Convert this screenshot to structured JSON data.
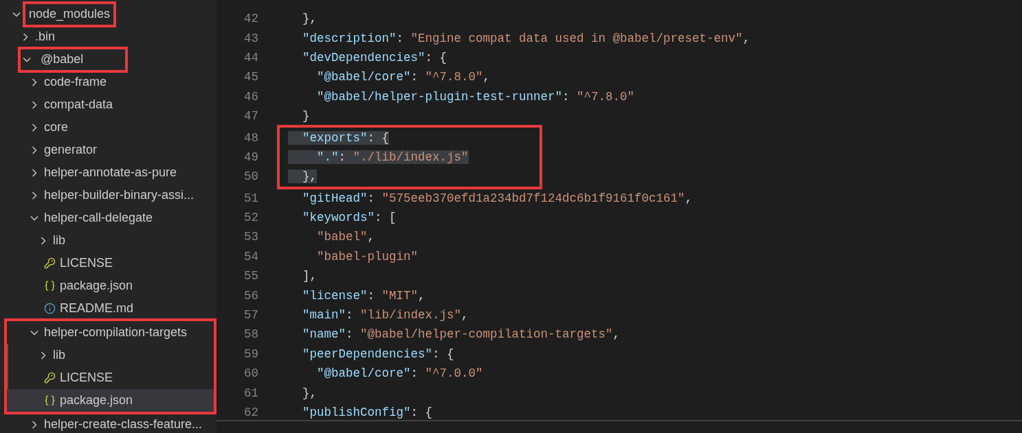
{
  "explorer": {
    "items": [
      {
        "name": "node_modules",
        "kind": "folder",
        "expanded": true,
        "selected": false,
        "label_boxed": true,
        "children": [
          {
            "name": ".bin",
            "kind": "folder",
            "expanded": false,
            "selected": false
          },
          {
            "name": "@babel",
            "kind": "folder",
            "expanded": true,
            "selected": false,
            "row_boxed": true,
            "children": [
              {
                "name": "code-frame",
                "kind": "folder",
                "expanded": false,
                "selected": false
              },
              {
                "name": "compat-data",
                "kind": "folder",
                "expanded": false,
                "selected": false
              },
              {
                "name": "core",
                "kind": "folder",
                "expanded": false,
                "selected": false
              },
              {
                "name": "generator",
                "kind": "folder",
                "expanded": false,
                "selected": false
              },
              {
                "name": "helper-annotate-as-pure",
                "kind": "folder",
                "expanded": false,
                "selected": false
              },
              {
                "name": "helper-builder-binary-assi...",
                "kind": "folder",
                "expanded": false,
                "selected": false
              },
              {
                "name": "helper-call-delegate",
                "kind": "folder",
                "expanded": true,
                "selected": false,
                "children": [
                  {
                    "name": "lib",
                    "kind": "folder",
                    "expanded": false,
                    "selected": false
                  },
                  {
                    "name": "LICENSE",
                    "kind": "license",
                    "selected": false
                  },
                  {
                    "name": "package.json",
                    "kind": "json",
                    "selected": false
                  },
                  {
                    "name": "README.md",
                    "kind": "readme",
                    "selected": false
                  }
                ]
              },
              {
                "name": "helper-compilation-targets",
                "kind": "folder",
                "expanded": true,
                "selected": false,
                "group_boxed": true,
                "children": [
                  {
                    "name": "lib",
                    "kind": "folder",
                    "expanded": false,
                    "selected": false
                  },
                  {
                    "name": "LICENSE",
                    "kind": "license",
                    "selected": false
                  },
                  {
                    "name": "package.json",
                    "kind": "json",
                    "selected": true
                  }
                ]
              },
              {
                "name": "helper-create-class-feature...",
                "kind": "folder",
                "expanded": false,
                "selected": false
              }
            ]
          }
        ]
      }
    ]
  },
  "editor": {
    "lines": [
      {
        "number": "42",
        "selected": false,
        "boxed": false,
        "tokens": [
          {
            "kind": "punct",
            "text": "  },"
          }
        ]
      },
      {
        "number": "43",
        "selected": false,
        "boxed": false,
        "tokens": [
          {
            "kind": "key",
            "text": "  \"description\""
          },
          {
            "kind": "punct",
            "text": ": "
          },
          {
            "kind": "string",
            "text": "\"Engine compat data used in @babel/preset-env\""
          },
          {
            "kind": "punct",
            "text": ","
          }
        ]
      },
      {
        "number": "44",
        "selected": false,
        "boxed": false,
        "tokens": [
          {
            "kind": "key",
            "text": "  \"devDependencies\""
          },
          {
            "kind": "punct",
            "text": ": {"
          }
        ]
      },
      {
        "number": "45",
        "selected": false,
        "boxed": false,
        "tokens": [
          {
            "kind": "key",
            "text": "    \"@babel/core\""
          },
          {
            "kind": "punct",
            "text": ": "
          },
          {
            "kind": "string",
            "text": "\"^7.8.0\""
          },
          {
            "kind": "punct",
            "text": ","
          }
        ]
      },
      {
        "number": "46",
        "selected": false,
        "boxed": false,
        "tokens": [
          {
            "kind": "key",
            "text": "    \"@babel/helper-plugin-test-runner\""
          },
          {
            "kind": "punct",
            "text": ": "
          },
          {
            "kind": "string",
            "text": "\"^7.8.0\""
          }
        ]
      },
      {
        "number": "47",
        "selected": false,
        "boxed": false,
        "tokens": [
          {
            "kind": "punct",
            "text": "  }"
          }
        ]
      },
      {
        "number": "48",
        "selected": true,
        "boxed": true,
        "tokens": [
          {
            "kind": "key",
            "text": "  \"exports\""
          },
          {
            "kind": "punct",
            "text": ": {"
          }
        ]
      },
      {
        "number": "49",
        "selected": true,
        "boxed": true,
        "tokens": [
          {
            "kind": "key",
            "text": "    \".\""
          },
          {
            "kind": "punct",
            "text": ": "
          },
          {
            "kind": "string",
            "text": "\"./lib/index.js\""
          }
        ]
      },
      {
        "number": "50",
        "selected": true,
        "boxed": true,
        "tokens": [
          {
            "kind": "punct",
            "text": "  },"
          }
        ]
      },
      {
        "number": "51",
        "selected": false,
        "boxed": false,
        "tokens": [
          {
            "kind": "key",
            "text": "  \"gitHead\""
          },
          {
            "kind": "punct",
            "text": ": "
          },
          {
            "kind": "string",
            "text": "\"575eeb370efd1a234bd7f124dc6b1f9161f0c161\""
          },
          {
            "kind": "punct",
            "text": ","
          }
        ]
      },
      {
        "number": "52",
        "selected": false,
        "boxed": false,
        "tokens": [
          {
            "kind": "key",
            "text": "  \"keywords\""
          },
          {
            "kind": "punct",
            "text": ": ["
          }
        ]
      },
      {
        "number": "53",
        "selected": false,
        "boxed": false,
        "tokens": [
          {
            "kind": "string",
            "text": "    \"babel\""
          },
          {
            "kind": "punct",
            "text": ","
          }
        ]
      },
      {
        "number": "54",
        "selected": false,
        "boxed": false,
        "tokens": [
          {
            "kind": "string",
            "text": "    \"babel-plugin\""
          }
        ]
      },
      {
        "number": "55",
        "selected": false,
        "boxed": false,
        "tokens": [
          {
            "kind": "punct",
            "text": "  ],"
          }
        ]
      },
      {
        "number": "56",
        "selected": false,
        "boxed": false,
        "tokens": [
          {
            "kind": "key",
            "text": "  \"license\""
          },
          {
            "kind": "punct",
            "text": ": "
          },
          {
            "kind": "string",
            "text": "\"MIT\""
          },
          {
            "kind": "punct",
            "text": ","
          }
        ]
      },
      {
        "number": "57",
        "selected": false,
        "boxed": false,
        "tokens": [
          {
            "kind": "key",
            "text": "  \"main\""
          },
          {
            "kind": "punct",
            "text": ": "
          },
          {
            "kind": "string",
            "text": "\"lib/index.js\""
          },
          {
            "kind": "punct",
            "text": ","
          }
        ]
      },
      {
        "number": "58",
        "selected": false,
        "boxed": false,
        "tokens": [
          {
            "kind": "key",
            "text": "  \"name\""
          },
          {
            "kind": "punct",
            "text": ": "
          },
          {
            "kind": "string",
            "text": "\"@babel/helper-compilation-targets\""
          },
          {
            "kind": "punct",
            "text": ","
          }
        ]
      },
      {
        "number": "59",
        "selected": false,
        "boxed": false,
        "tokens": [
          {
            "kind": "key",
            "text": "  \"peerDependencies\""
          },
          {
            "kind": "punct",
            "text": ": {"
          }
        ]
      },
      {
        "number": "60",
        "selected": false,
        "boxed": false,
        "tokens": [
          {
            "kind": "key",
            "text": "    \"@babel/core\""
          },
          {
            "kind": "punct",
            "text": ": "
          },
          {
            "kind": "string",
            "text": "\"^7.0.0\""
          }
        ]
      },
      {
        "number": "61",
        "selected": false,
        "boxed": false,
        "tokens": [
          {
            "kind": "punct",
            "text": "  },"
          }
        ]
      },
      {
        "number": "62",
        "selected": false,
        "boxed": false,
        "tokens": [
          {
            "kind": "key",
            "text": "  \"publishConfig\""
          },
          {
            "kind": "punct",
            "text": ": {"
          }
        ]
      }
    ]
  }
}
